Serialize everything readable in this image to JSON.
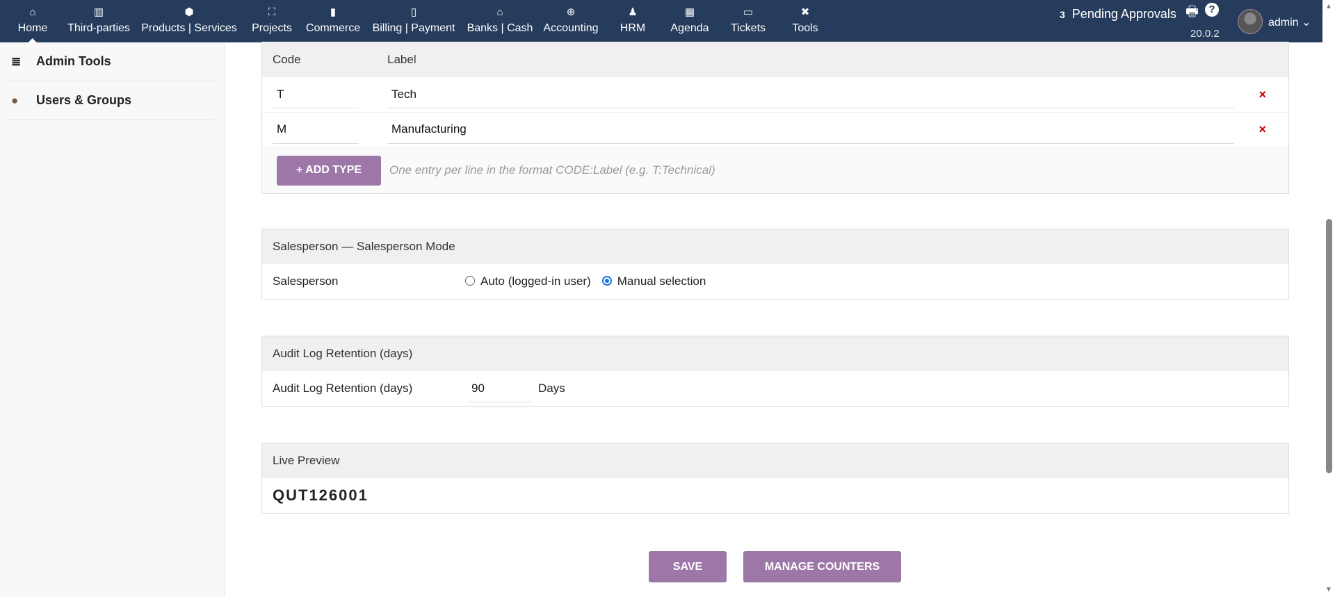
{
  "nav": {
    "items": [
      {
        "label": "Home",
        "icon": "home-icon",
        "glyph": "⌂"
      },
      {
        "label": "Third-parties",
        "icon": "building-icon",
        "glyph": "▥"
      },
      {
        "label": "Products | Services",
        "icon": "cube-icon",
        "glyph": "⬢"
      },
      {
        "label": "Projects",
        "icon": "sitemap-icon",
        "glyph": "⛶"
      },
      {
        "label": "Commerce",
        "icon": "suitcase-icon",
        "glyph": "▮"
      },
      {
        "label": "Billing | Payment",
        "icon": "invoice-icon",
        "glyph": "▯"
      },
      {
        "label": "Banks | Cash",
        "icon": "bank-icon",
        "glyph": "⌂"
      },
      {
        "label": "Accounting",
        "icon": "search-dollar-icon",
        "glyph": "⊕"
      },
      {
        "label": "HRM",
        "icon": "user-tie-icon",
        "glyph": "♟"
      },
      {
        "label": "Agenda",
        "icon": "calendar-icon",
        "glyph": "▦"
      },
      {
        "label": "Tickets",
        "icon": "ticket-icon",
        "glyph": "▭"
      },
      {
        "label": "Tools",
        "icon": "tools-icon",
        "glyph": "✖"
      }
    ],
    "pending_count": "3",
    "pending_label": "Pending Approvals",
    "version": "20.0.2",
    "user": "admin"
  },
  "sidebar": {
    "items": [
      {
        "label": "Admin Tools",
        "glyph": "≣"
      },
      {
        "label": "Users & Groups",
        "glyph": "👤"
      }
    ]
  },
  "types": {
    "col_code": "Code",
    "col_label": "Label",
    "rows": [
      {
        "code": "T",
        "label": "Tech"
      },
      {
        "code": "M",
        "label": "Manufacturing"
      }
    ],
    "add_label": "+ ADD TYPE",
    "hint": "One entry per line in the format CODE:Label (e.g. T:Technical)",
    "delete_glyph": "×"
  },
  "salesperson": {
    "title": "Salesperson — Salesperson Mode",
    "label": "Salesperson",
    "opt_auto": "Auto (logged-in user)",
    "opt_manual": "Manual selection",
    "selected": "manual"
  },
  "audit": {
    "title": "Audit Log Retention (days)",
    "label": "Audit Log Retention (days)",
    "value": "90",
    "unit": "Days"
  },
  "preview": {
    "title": "Live Preview",
    "value": "QUT126001"
  },
  "actions": {
    "save": "SAVE",
    "manage": "MANAGE COUNTERS"
  },
  "colors": {
    "nav": "#263c5c",
    "accent": "#9e77a9"
  }
}
